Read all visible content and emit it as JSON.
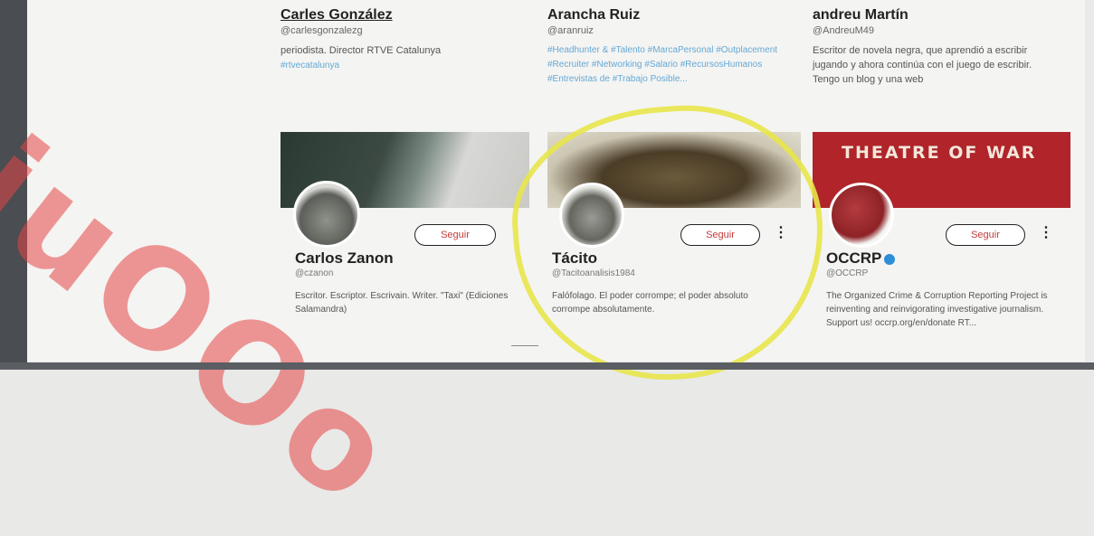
{
  "watermark": "juOOo",
  "suggestions_top": [
    {
      "name": "Carles González",
      "handle": "@carlesgonzalezg",
      "bio": "periodista. Director RTVE Catalunya",
      "tags": "#rtvecatalunya"
    },
    {
      "name": "Arancha Ruiz",
      "handle": "@aranruiz",
      "bio": "",
      "tags": "#Headhunter & #Talento #MarcaPersonal #Outplacement #Recruiter #Networking #Salario #RecursosHumanos #Entrevistas de #Trabajo Posible..."
    },
    {
      "name": "andreu Martín",
      "handle": "@AndreuM49",
      "bio": "Escritor de novela negra, que aprendió a escribir jugando y ahora continúa con el juego de escribir. Tengo un blog y una web",
      "tags": ""
    }
  ],
  "cards": [
    {
      "name": "Carlos Zanon",
      "handle": "@czanon",
      "follow": "Seguir",
      "bio": "Escritor. Escriptor. Escrivain. Writer. \"Taxi\" (Ediciones Salamandra)"
    },
    {
      "name": "Tácito",
      "handle": "@Tacitoanalisis1984",
      "follow": "Seguir",
      "bio": "Falófolago. El poder corrompe; el poder absoluto corrompe absolutamente."
    },
    {
      "name": "OCCRP",
      "handle": "@OCCRP",
      "follow": "Seguir",
      "bio": "The Organized Crime & Corruption Reporting Project is reinventing and reinvigorating investigative journalism. Support us! occrp.org/en/donate RT..."
    }
  ],
  "banner_text": "THEATRE OF WAR",
  "colors": {
    "accent": "#c23a3a",
    "link": "#64a8d6",
    "highlight": "#e8e54a",
    "watermark": "#e64646"
  },
  "icons": {
    "verified": "verified-badge-icon",
    "more": "more-options-icon"
  }
}
